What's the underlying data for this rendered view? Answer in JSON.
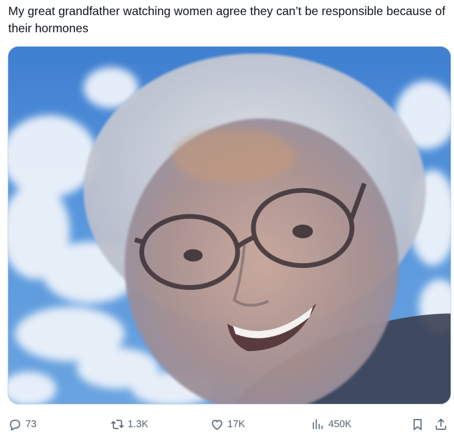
{
  "post": {
    "text": "My great grandfather watching women agree they can’t be responsible because of their hormones"
  },
  "media": {
    "icon": "photo"
  },
  "actions": {
    "replies": "73",
    "reposts": "1.3K",
    "likes": "17K",
    "views": "450K",
    "reply_icon": "reply-icon",
    "repost_icon": "repost-icon",
    "like_icon": "heart-icon",
    "views_icon": "views-icon",
    "bookmark_icon": "bookmark-icon",
    "share_icon": "share-icon"
  },
  "colors": {
    "text": "#0f1419",
    "muted": "#536471",
    "sky": "#4f8fd6"
  }
}
